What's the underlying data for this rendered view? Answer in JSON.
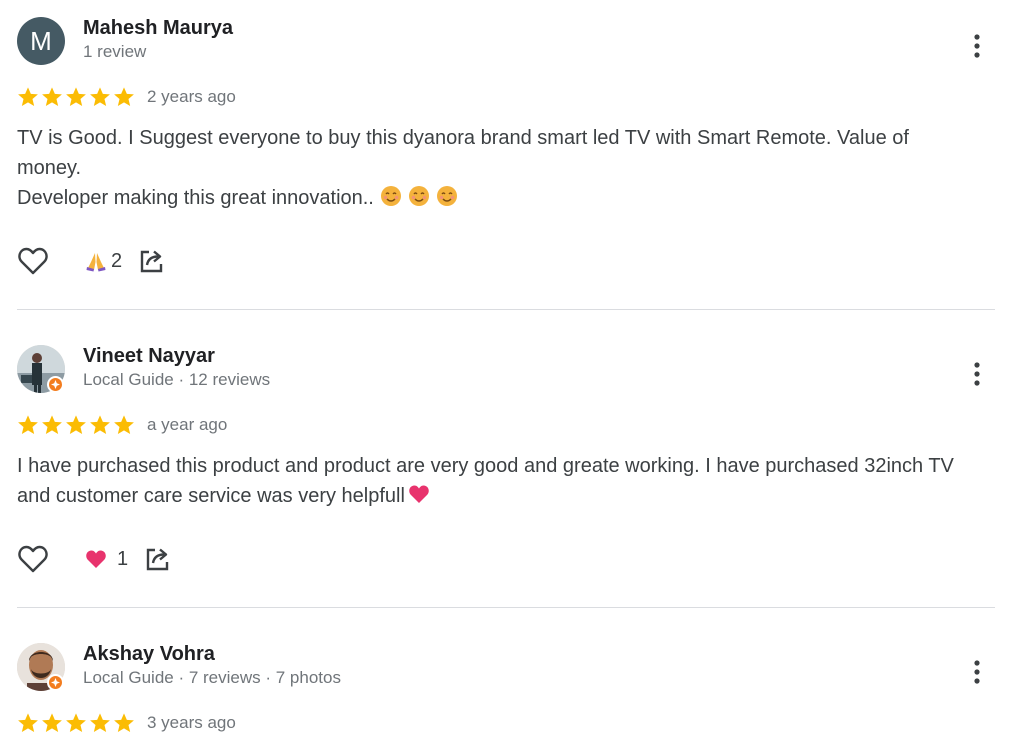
{
  "reviews": [
    {
      "name": "Mahesh Maurya",
      "avatar_letter": "M",
      "meta": "1 review",
      "stars": 5,
      "time": "2 years ago",
      "body_lines": [
        "TV is Good. I Suggest everyone to buy this dyanora brand smart led TV with Smart Remote. Value of money.",
        "Developer making this great innovation.."
      ],
      "reaction_icon": "folded-hands-icon",
      "reaction_count": "2"
    },
    {
      "name": "Vineet Nayyar",
      "meta": "Local Guide · 12 reviews",
      "stars": 5,
      "time": "a year ago",
      "body_lines": [
        "I have purchased this product and product are very good and greate working. I have purchased 32inch TV and customer care service was very helpfull"
      ],
      "reaction_icon": "heart-emoji-icon",
      "reaction_count": "1"
    },
    {
      "name": "Akshay Vohra",
      "meta": "Local Guide · 7 reviews · 7 photos",
      "stars": 5,
      "time": "3 years ago"
    }
  ],
  "colors": {
    "star": "#fbbc04",
    "avatar_bg": "#455a64",
    "local_guide_badge": "#f37d1f",
    "divider": "#dadce0"
  }
}
